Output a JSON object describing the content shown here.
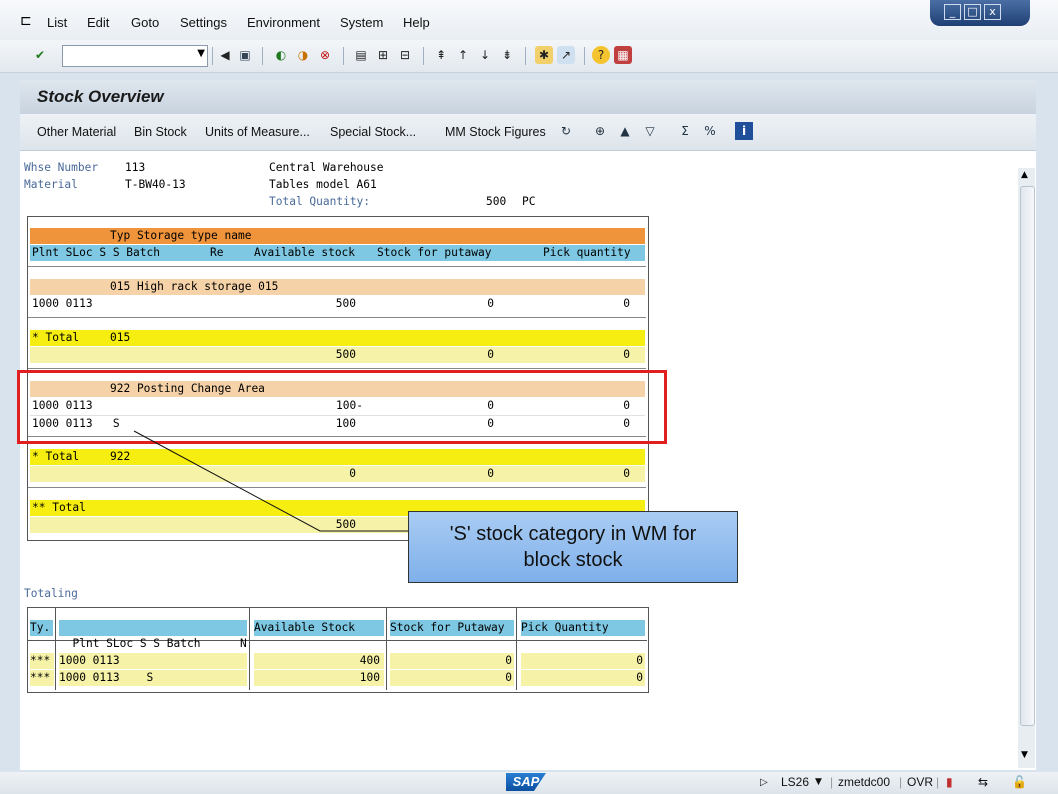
{
  "menu": {
    "items": [
      "List",
      "Edit",
      "Goto",
      "Settings",
      "Environment",
      "System",
      "Help"
    ]
  },
  "toolbar": {
    "command_value": ""
  },
  "screen": {
    "title": "Stock Overview"
  },
  "app_toolbar": {
    "buttons": [
      "Other Material",
      "Bin Stock",
      "Units of Measure...",
      "Special Stock...",
      "MM Stock Figures"
    ]
  },
  "header": {
    "whse_label": "Whse Number",
    "whse_value": "113",
    "whse_desc": "Central Warehouse",
    "material_label": "Material",
    "material_value": "T-BW40-13",
    "material_desc": "Tables model A61",
    "total_qty_label": "Total Quantity:",
    "total_qty_value": "500",
    "total_qty_unit": "PC"
  },
  "list": {
    "head1": "Typ Storage type name",
    "head2": {
      "c1": "Plnt SLoc S S Batch",
      "c2": "Re",
      "c3": "Available stock",
      "c4": "Stock for putaway",
      "c5": "Pick quantity"
    },
    "group1": {
      "title": "015 High rack storage 015",
      "rows": [
        {
          "key": "1000 0113",
          "avail": "500",
          "putaway": "0",
          "pick": "0"
        }
      ]
    },
    "total1": {
      "label": "* Total",
      "typ": "015",
      "avail": "500",
      "putaway": "0",
      "pick": "0"
    },
    "group2": {
      "title": "922 Posting Change Area",
      "rows": [
        {
          "key": "1000 0113",
          "avail": "100-",
          "putaway": "0",
          "pick": "0"
        },
        {
          "key": "1000 0113   S",
          "avail": "100",
          "putaway": "0",
          "pick": "0"
        }
      ]
    },
    "total2": {
      "label": "* Total",
      "typ": "922",
      "avail": "0",
      "putaway": "0",
      "pick": "0"
    },
    "grand": {
      "label": "** Total",
      "avail": "500"
    }
  },
  "callout": {
    "line1": "'S' stock category in WM for",
    "line2": "block stock"
  },
  "totaling": {
    "title": "Totaling",
    "headers": {
      "ty": "Ty.",
      "key": "Plnt SLoc S S Batch",
      "n": "N",
      "avail": "Available Stock",
      "putaway": "Stock for Putaway",
      "pick": "Pick Quantity"
    },
    "rows": [
      {
        "ty": "***",
        "key": "1000 0113",
        "avail": "400",
        "putaway": "0",
        "pick": "0"
      },
      {
        "ty": "***",
        "key": "1000 0113    S",
        "avail": "100",
        "putaway": "0",
        "pick": "0"
      }
    ]
  },
  "status": {
    "logo": "SAP",
    "transaction": "LS26",
    "server": "zmetdc00",
    "mode": "OVR"
  }
}
